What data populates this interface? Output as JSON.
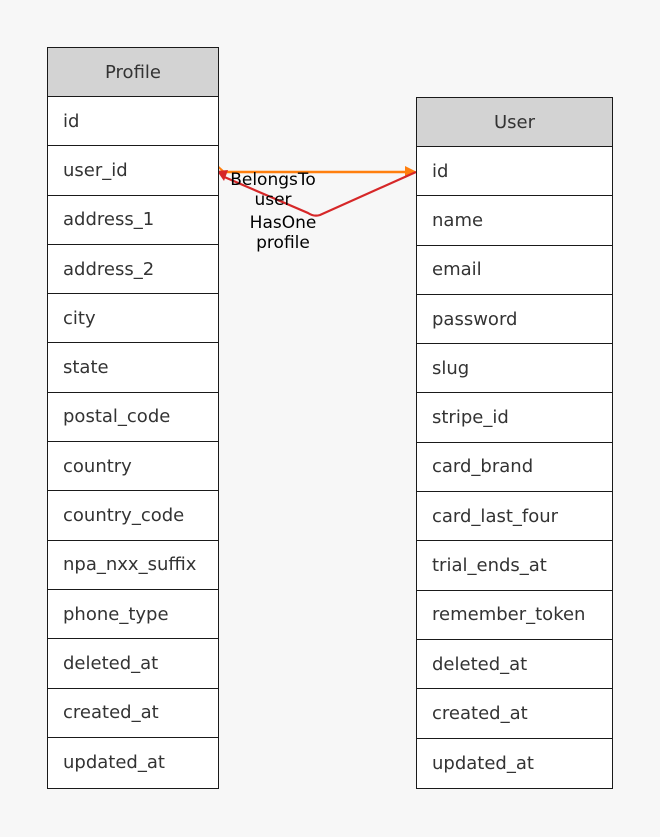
{
  "entities": {
    "profile": {
      "name": "Profile",
      "fields": [
        "id",
        "user_id",
        "address_1",
        "address_2",
        "city",
        "state",
        "postal_code",
        "country",
        "country_code",
        "npa_nxx_suffix",
        "phone_type",
        "deleted_at",
        "created_at",
        "updated_at"
      ]
    },
    "user": {
      "name": "User",
      "fields": [
        "id",
        "name",
        "email",
        "password",
        "slug",
        "stripe_id",
        "card_brand",
        "card_last_four",
        "trial_ends_at",
        "remember_token",
        "deleted_at",
        "created_at",
        "updated_at"
      ]
    }
  },
  "relations": {
    "belongs_to": {
      "type": "BelongsTo",
      "name": "user",
      "from": "Profile.user_id",
      "to": "User.id",
      "color": "#ff7f0e"
    },
    "has_one": {
      "type": "HasOne",
      "name": "profile",
      "from": "User.id",
      "to": "Profile.user_id",
      "color": "#d62728"
    }
  }
}
